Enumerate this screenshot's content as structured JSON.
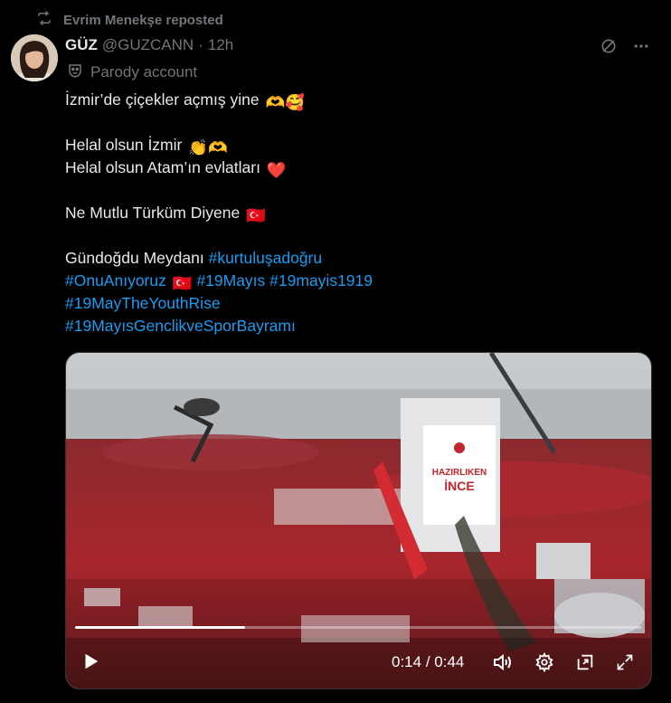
{
  "repost": {
    "text": "Evrim Menekşe reposted"
  },
  "author": {
    "name": "GÜZ",
    "handle": "@GUZCANN",
    "dot": "·",
    "time": "12h",
    "label": "Parody account"
  },
  "body": {
    "l1": "İzmir’de çiçekler açmış yine",
    "l1_emoji": "🫶🥰",
    "l2": "Helal olsun İzmir",
    "l2_emoji": "👏🫶",
    "l3": "Helal olsun Atam’ın evlatları",
    "l3_emoji": "❤️",
    "l4": "Ne Mutlu Türküm Diyene",
    "l4_emoji": "🇹🇷",
    "l5_text": "Gündoğdu Meydanı ",
    "l5_tag": "#kurtuluşadoğru",
    "l6_tag1": "#OnuAnıyoruz",
    "l6_flag": "🇹🇷",
    "l6_tag2": "#19Mayıs",
    "l6_tag3": "#19mayis1919",
    "l7_tag": "#19MayTheYouthRise",
    "l8_tag": "#19MayısGenclikveSporBayramı"
  },
  "video": {
    "current": "0:14",
    "separator": "/",
    "duration": "0:44",
    "progress": 0.3,
    "sign_text_1": "HAZIRLIKEN",
    "sign_text_2": "İNCE"
  },
  "icons": [
    "repost-icon",
    "grok-icon",
    "more-icon",
    "parody-mask-icon",
    "play-icon",
    "volume-icon",
    "settings-icon",
    "pip-icon",
    "fullscreen-icon"
  ],
  "colors": {
    "background": "#000000",
    "text": "#e7e9ea",
    "muted": "#71767b",
    "link": "#1d9bf0"
  }
}
